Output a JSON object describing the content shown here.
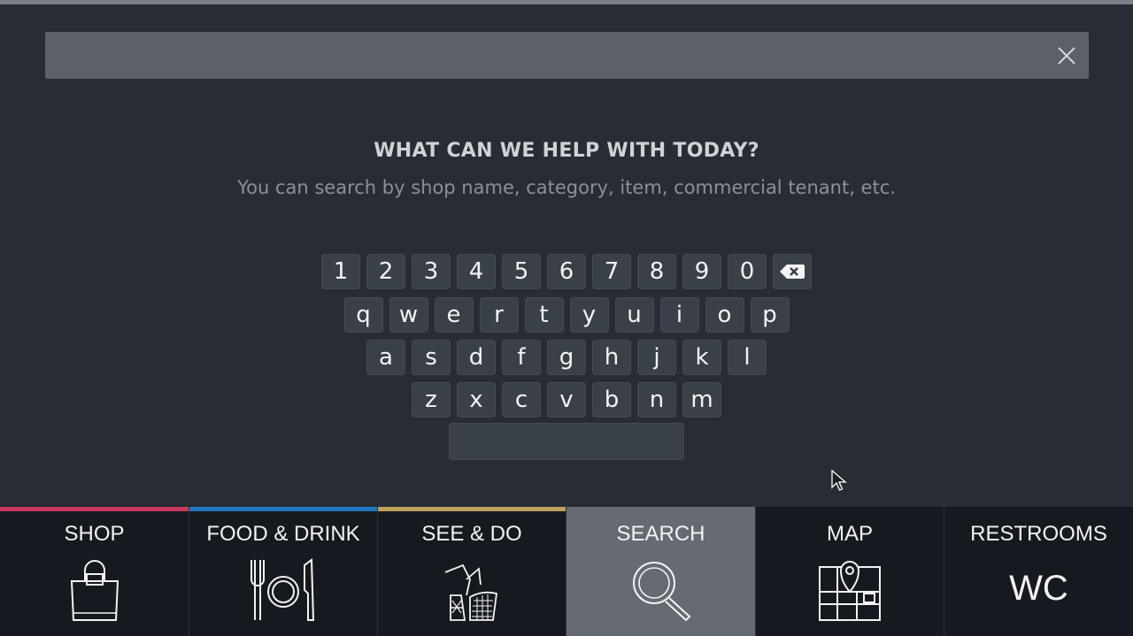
{
  "search": {
    "value": "",
    "placeholder": ""
  },
  "heading": {
    "title": "WHAT CAN WE HELP WITH TODAY?",
    "subtitle": "You can search by shop name, category, item, commercial tenant, etc."
  },
  "keyboard": {
    "number_row": [
      "1",
      "2",
      "3",
      "4",
      "5",
      "6",
      "7",
      "8",
      "9",
      "0"
    ],
    "row1": [
      "q",
      "w",
      "e",
      "r",
      "t",
      "y",
      "u",
      "i",
      "o",
      "p"
    ],
    "row2": [
      "a",
      "s",
      "d",
      "f",
      "g",
      "h",
      "j",
      "k",
      "l"
    ],
    "row3": [
      "z",
      "x",
      "c",
      "v",
      "b",
      "n",
      "m"
    ],
    "backspace_icon": "backspace-icon",
    "space_label": ""
  },
  "nav": {
    "items": [
      {
        "label": "SHOP",
        "icon": "shopping-bag-icon",
        "accent": "#c8385f"
      },
      {
        "label": "FOOD & DRINK",
        "icon": "plate-cutlery-icon",
        "accent": "#1f77c4"
      },
      {
        "label": "SEE & DO",
        "icon": "sculpture-icon",
        "accent": "#bfa15a"
      },
      {
        "label": "SEARCH",
        "icon": "magnifier-icon",
        "accent": "#666a72",
        "active": true
      },
      {
        "label": "MAP",
        "icon": "map-pin-icon",
        "accent": "#161a20"
      },
      {
        "label": "RESTROOMS",
        "icon_text": "WC",
        "accent": "#161a20"
      }
    ]
  },
  "colors": {
    "background": "#282c34",
    "search_bar": "#5c6068",
    "key": "#3a4047",
    "nav_bg": "#161a20",
    "nav_active": "#666a72"
  }
}
